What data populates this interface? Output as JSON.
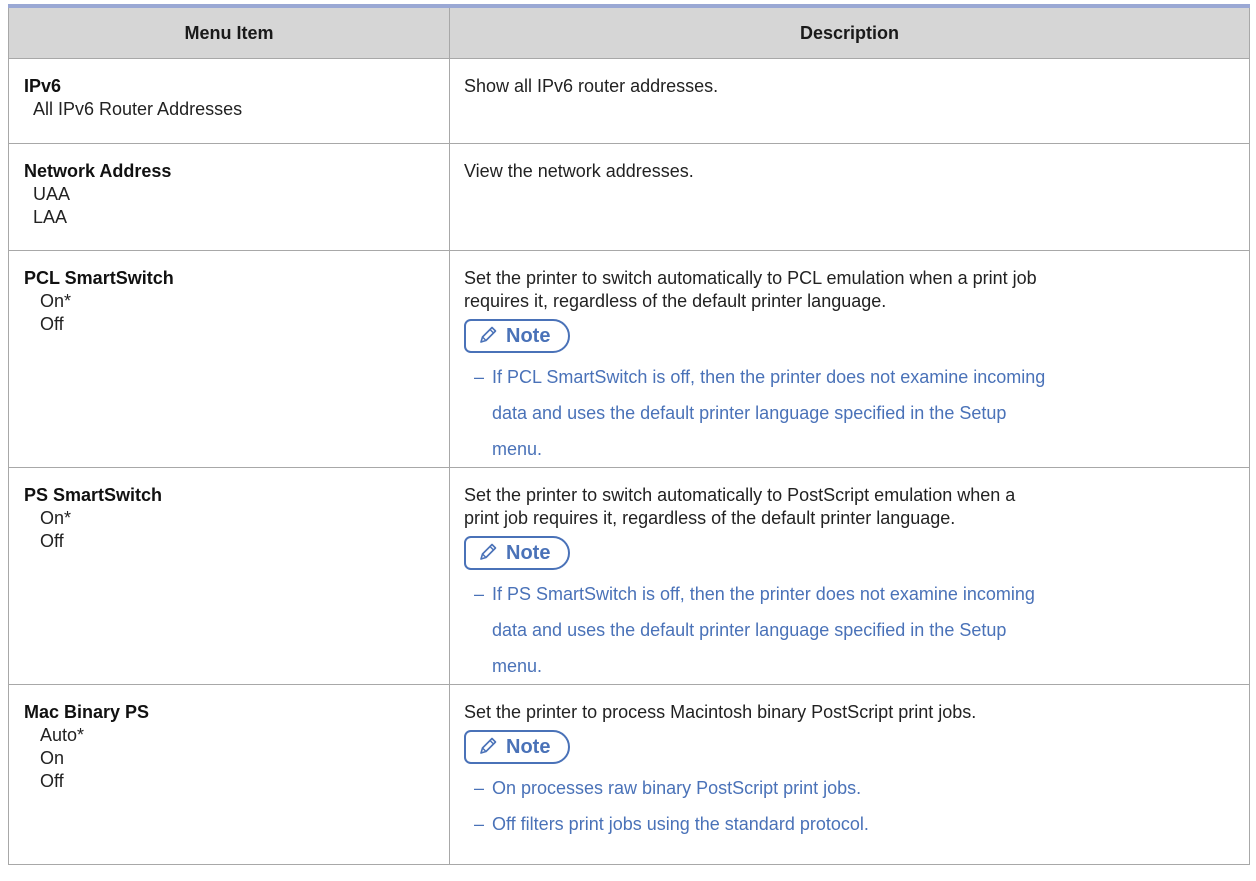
{
  "header": {
    "col_item": "Menu Item",
    "col_desc": "Description"
  },
  "note_label": "Note",
  "rows": [
    {
      "title": "IPv6",
      "options": [
        "All IPv6 Router Addresses"
      ],
      "description": "Show all IPv6 router addresses."
    },
    {
      "title": "Network Address",
      "options": [
        "UAA",
        "LAA"
      ],
      "description": "View the network addresses."
    },
    {
      "title": "PCL SmartSwitch",
      "options": [
        "On*",
        "Off"
      ],
      "description_lines": [
        "Set the printer to switch automatically to PCL emulation when a print job",
        "requires it, regardless of the default printer language."
      ],
      "note_lines": [
        "If PCL SmartSwitch is off, then the printer does not examine incoming",
        "data and uses the default printer language specified in the Setup",
        "menu."
      ]
    },
    {
      "title": "PS SmartSwitch",
      "options": [
        "On*",
        "Off"
      ],
      "description_lines": [
        "Set the printer to switch automatically to PostScript emulation when a",
        "print job requires it, regardless of the default printer language."
      ],
      "note_lines": [
        "If PS SmartSwitch is off, then the printer does not examine incoming",
        "data and uses the default printer language specified in the Setup",
        "menu."
      ]
    },
    {
      "title": "Mac Binary PS",
      "options": [
        "Auto*",
        "On",
        "Off"
      ],
      "description": "Set the printer to process Macintosh binary PostScript print jobs.",
      "notes": [
        "On processes raw binary PostScript print jobs.",
        "Off filters print jobs using the standard protocol."
      ]
    }
  ],
  "colors": {
    "header_bg": "#d6d6d6",
    "header_top_border": "#9aa8d4",
    "note_blue": "#4a72b8",
    "grid": "#a8a8a8"
  }
}
